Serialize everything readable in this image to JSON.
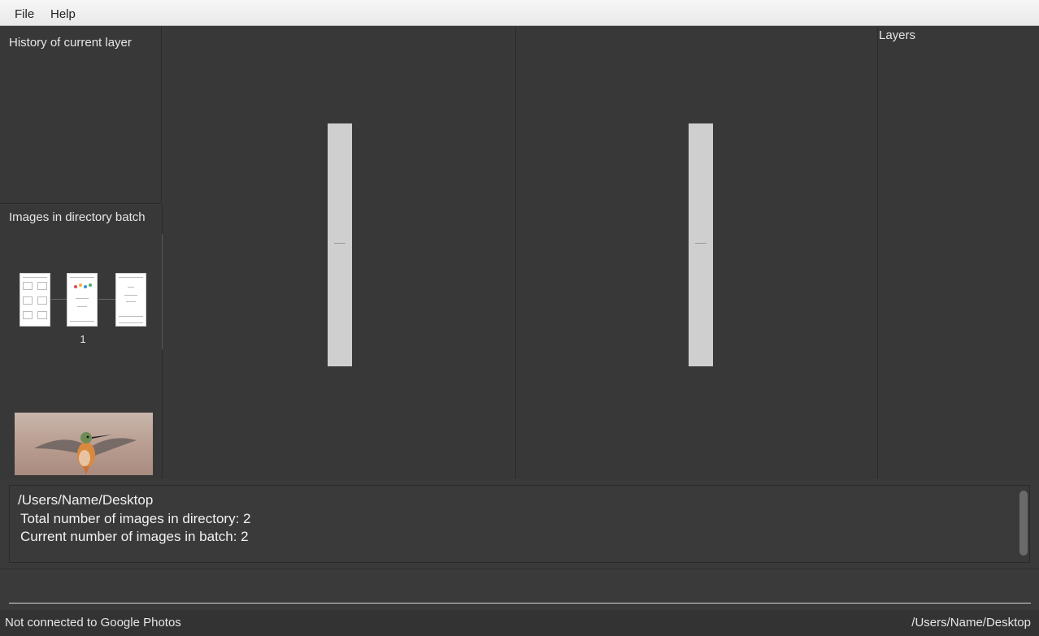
{
  "menu": {
    "file": "File",
    "help": "Help"
  },
  "history_panel": {
    "title": "History of current layer"
  },
  "batch_panel": {
    "title": "Images in directory batch",
    "index_label": "1"
  },
  "layers_panel": {
    "title": "Layers"
  },
  "info": {
    "path": "/Users/Name/Desktop",
    "total_images": "Total number of images in directory: 2",
    "current_batch": "Current number of images in batch: 2"
  },
  "status": {
    "connection": "Not connected to Google Photos",
    "path": "/Users/Name/Desktop"
  },
  "colors": {
    "background": "#383838",
    "menubar": "#ececec",
    "image_strip": "#cfcfcf"
  }
}
